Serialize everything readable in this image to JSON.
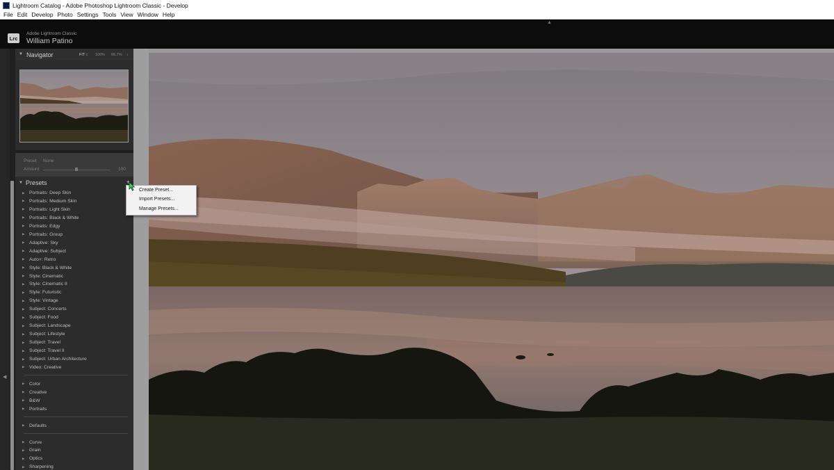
{
  "window": {
    "title": "Lightroom Catalog - Adobe Photoshop Lightroom Classic - Develop"
  },
  "menubar": {
    "items": [
      "File",
      "Edit",
      "Develop",
      "Photo",
      "Settings",
      "Tools",
      "View",
      "Window",
      "Help"
    ]
  },
  "identity": {
    "logo": "Lrc",
    "product": "Adobe Lightroom Classic",
    "user": "William Patino"
  },
  "navigator": {
    "title": "Navigator",
    "zoom_options": [
      "FIT ↕",
      "100%",
      "66.7%"
    ],
    "zoom_more": "↕"
  },
  "preset_amount": {
    "preset_label": "Preset",
    "preset_value": "None",
    "amount_label": "Amount",
    "amount_value": "100",
    "amount_fraction": 0.5
  },
  "presets": {
    "title": "Presets",
    "add_symbol": "+",
    "groups": [
      [
        "Portraits: Deep Skin",
        "Portraits: Medium Skin",
        "Portraits: Light Skin",
        "Portraits: Black & White",
        "Portraits: Edgy",
        "Portraits: Group",
        "Adaptive: Sky",
        "Adaptive: Subject",
        "Auto+: Retro",
        "Style: Black & White",
        "Style: Cinematic",
        "Style: Cinematic II",
        "Style: Futuristic",
        "Style: Vintage",
        "Subject: Concerts",
        "Subject: Food",
        "Subject: Landscape",
        "Subject: Lifestyle",
        "Subject: Travel",
        "Subject: Travel II",
        "Subject: Urban Architecture",
        "Video: Creative"
      ],
      [
        "Color",
        "Creative",
        "B&W",
        "Portraits"
      ],
      [
        "Defaults"
      ],
      [
        "Curve",
        "Grain",
        "Optics",
        "Sharpening"
      ]
    ]
  },
  "context_menu": {
    "items": [
      "Create Preset...",
      "Import Presets...",
      "Manage Presets..."
    ]
  },
  "colors": {
    "panel_bg": "#2c2c2c",
    "identity_bg": "#0c0c0c",
    "menu_bg": "#f2f2f2"
  },
  "icons": {
    "collapse": "triangle-down-icon",
    "preset_item": "triangle-right-icon",
    "cursor": "arrow-cursor-icon"
  }
}
